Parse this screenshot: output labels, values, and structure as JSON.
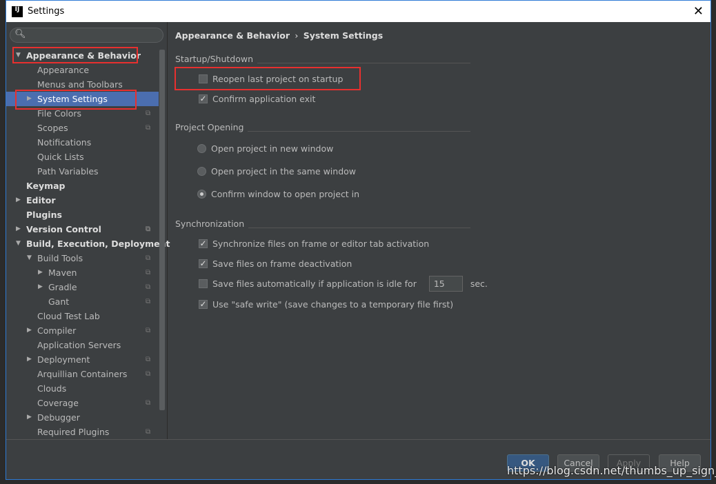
{
  "window": {
    "title": "Settings",
    "logo": "IJ",
    "close": "✕"
  },
  "search": {
    "placeholder": ""
  },
  "tree": [
    {
      "label": "Appearance & Behavior",
      "level": 0,
      "arrow": "down",
      "bold": true
    },
    {
      "label": "Appearance",
      "level": 1
    },
    {
      "label": "Menus and Toolbars",
      "level": 1
    },
    {
      "label": "System Settings",
      "level": 1,
      "arrow": "right",
      "selected": true
    },
    {
      "label": "File Colors",
      "level": 1,
      "copy": true
    },
    {
      "label": "Scopes",
      "level": 1,
      "copy": true
    },
    {
      "label": "Notifications",
      "level": 1
    },
    {
      "label": "Quick Lists",
      "level": 1
    },
    {
      "label": "Path Variables",
      "level": 1
    },
    {
      "label": "Keymap",
      "level": 0,
      "bold": true
    },
    {
      "label": "Editor",
      "level": 0,
      "arrow": "right",
      "bold": true
    },
    {
      "label": "Plugins",
      "level": 0,
      "bold": true
    },
    {
      "label": "Version Control",
      "level": 0,
      "arrow": "right",
      "bold": true,
      "copy": true
    },
    {
      "label": "Build, Execution, Deployment",
      "level": 0,
      "arrow": "down",
      "bold": true
    },
    {
      "label": "Build Tools",
      "level": 1,
      "arrow": "down",
      "copy": true
    },
    {
      "label": "Maven",
      "level": 2,
      "arrow": "right",
      "copy": true
    },
    {
      "label": "Gradle",
      "level": 2,
      "arrow": "right",
      "copy": true
    },
    {
      "label": "Gant",
      "level": 2,
      "copy": true
    },
    {
      "label": "Cloud Test Lab",
      "level": 1
    },
    {
      "label": "Compiler",
      "level": 1,
      "arrow": "right",
      "copy": true
    },
    {
      "label": "Application Servers",
      "level": 1
    },
    {
      "label": "Deployment",
      "level": 1,
      "arrow": "right",
      "copy": true
    },
    {
      "label": "Arquillian Containers",
      "level": 1,
      "copy": true
    },
    {
      "label": "Clouds",
      "level": 1
    },
    {
      "label": "Coverage",
      "level": 1,
      "copy": true
    },
    {
      "label": "Debugger",
      "level": 1,
      "arrow": "right"
    },
    {
      "label": "Required Plugins",
      "level": 1,
      "copy": true
    }
  ],
  "breadcrumb": {
    "parent": "Appearance & Behavior",
    "sep": "›",
    "current": "System Settings"
  },
  "startup": {
    "title": "Startup/Shutdown",
    "reopen": "Reopen last project on startup",
    "reopen_checked": false,
    "confirm_exit": "Confirm application exit",
    "confirm_exit_checked": true
  },
  "opening": {
    "title": "Project Opening",
    "options": [
      "Open project in new window",
      "Open project in the same window",
      "Confirm window to open project in"
    ],
    "selected": 2
  },
  "sync": {
    "title": "Synchronization",
    "sync_files": "Synchronize files on frame or editor tab activation",
    "save_deactivation": "Save files on frame deactivation",
    "save_idle": "Save files automatically if application is idle for",
    "idle_value": "15",
    "idle_unit": "sec.",
    "safe_write": "Use \"safe write\" (save changes to a temporary file first)"
  },
  "buttons": {
    "ok": "OK",
    "cancel": "Cancel",
    "apply": "Apply",
    "help": "Help"
  },
  "watermark": "https://blog.csdn.net/thumbs_up_sign_ygj",
  "colors": {
    "highlight": "#e8302f",
    "selection": "#4b6eaf",
    "background": "#3c3f41"
  }
}
